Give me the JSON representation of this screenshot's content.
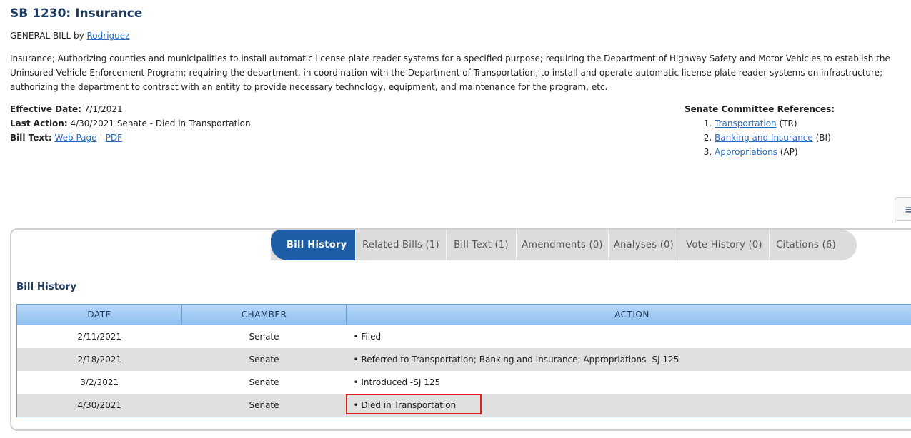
{
  "bill": {
    "title": "SB 1230: Insurance",
    "type_prefix": "GENERAL BILL by ",
    "sponsor": "Rodriguez",
    "description": "Insurance; Authorizing counties and municipalities to install automatic license plate reader systems for a specified purpose; requiring the Department of Highway Safety and Motor Vehicles to establish the Uninsured Vehicle Enforcement Program; requiring the department, in coordination with the Department of Transportation, to install and operate automatic license plate reader systems on infrastructure; authorizing the department to contract with an entity to provide necessary technology, equipment, and maintenance for the program, etc."
  },
  "meta": {
    "effective_label": "Effective Date:",
    "effective_value": "7/1/2021",
    "last_action_label": "Last Action:",
    "last_action_value": "4/30/2021 Senate - Died in Transportation",
    "bill_text_label": "Bill Text:",
    "web_page": "Web Page",
    "separator": "|",
    "pdf": "PDF"
  },
  "committee": {
    "heading": "Senate Committee References:",
    "items": [
      {
        "name": "Transportation",
        "code": "(TR)"
      },
      {
        "name": "Banking and Insurance",
        "code": "(BI)"
      },
      {
        "name": "Appropriations",
        "code": "(AP)"
      }
    ]
  },
  "side_button": {
    "icon": "≡"
  },
  "tabs": [
    {
      "label": "Bill History"
    },
    {
      "label": "Related Bills (1)"
    },
    {
      "label": "Bill Text (1)"
    },
    {
      "label": "Amendments (0)"
    },
    {
      "label": "Analyses (0)"
    },
    {
      "label": "Vote History (0)"
    },
    {
      "label": "Citations (6)"
    }
  ],
  "history": {
    "title": "Bill History",
    "columns": [
      "DATE",
      "CHAMBER",
      "ACTION"
    ],
    "rows": [
      {
        "date": "2/11/2021",
        "chamber": "Senate",
        "action": "• Filed"
      },
      {
        "date": "2/18/2021",
        "chamber": "Senate",
        "action": "• Referred to Transportation; Banking and Insurance; Appropriations -SJ 125"
      },
      {
        "date": "3/2/2021",
        "chamber": "Senate",
        "action": "• Introduced -SJ 125"
      },
      {
        "date": "4/30/2021",
        "chamber": "Senate",
        "action": "• Died in Transportation"
      }
    ]
  },
  "colors": {
    "title": "#1d3b5f",
    "link": "#2a6ebb",
    "active_tab": "#1d5ea6",
    "highlight": "#e01f1f"
  }
}
